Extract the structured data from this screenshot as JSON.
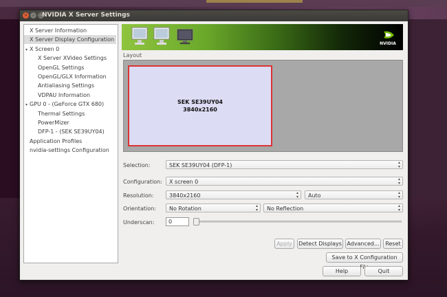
{
  "window": {
    "title": "NVIDIA X Server Settings"
  },
  "tree": {
    "items": [
      {
        "label": "X Server Information",
        "indent": 0,
        "expander": false,
        "selected": false
      },
      {
        "label": "X Server Display Configuration",
        "indent": 0,
        "expander": false,
        "selected": true
      },
      {
        "label": "X Screen 0",
        "indent": 0,
        "expander": true,
        "selected": false
      },
      {
        "label": "X Server XVideo Settings",
        "indent": 1,
        "expander": false,
        "selected": false
      },
      {
        "label": "OpenGL Settings",
        "indent": 1,
        "expander": false,
        "selected": false
      },
      {
        "label": "OpenGL/GLX Information",
        "indent": 1,
        "expander": false,
        "selected": false
      },
      {
        "label": "Antialiasing Settings",
        "indent": 1,
        "expander": false,
        "selected": false
      },
      {
        "label": "VDPAU Information",
        "indent": 1,
        "expander": false,
        "selected": false
      },
      {
        "label": "GPU 0 - (GeForce GTX 680)",
        "indent": 0,
        "expander": true,
        "selected": false
      },
      {
        "label": "Thermal Settings",
        "indent": 1,
        "expander": false,
        "selected": false
      },
      {
        "label": "PowerMizer",
        "indent": 1,
        "expander": false,
        "selected": false
      },
      {
        "label": "DFP-1 - (SEK SE39UY04)",
        "indent": 1,
        "expander": false,
        "selected": false
      },
      {
        "label": "Application Profiles",
        "indent": 0,
        "expander": false,
        "selected": false
      },
      {
        "label": "nvidia-settings Configuration",
        "indent": 0,
        "expander": false,
        "selected": false
      }
    ]
  },
  "banner": {
    "logo_text": "NVIDIA",
    "brand_color": "#76b900"
  },
  "layout": {
    "label": "Layout",
    "display_name": "SEK SE39UY04",
    "display_resolution": "3840x2160"
  },
  "form": {
    "selection_label": "Selection:",
    "selection_value": "SEK SE39UY04 (DFP-1)",
    "configuration_label": "Configuration:",
    "configuration_value": "X screen 0",
    "resolution_label": "Resolution:",
    "resolution_value": "3840x2160",
    "refresh_value": "Auto",
    "orientation_label": "Orientation:",
    "rotation_value": "No Rotation",
    "reflection_value": "No Reflection",
    "underscan_label": "Underscan:",
    "underscan_value": "0"
  },
  "buttons": {
    "apply": "Apply",
    "detect": "Detect Displays",
    "advanced": "Advanced...",
    "reset": "Reset",
    "save": "Save to X Configuration File",
    "help": "Help",
    "quit": "Quit"
  }
}
